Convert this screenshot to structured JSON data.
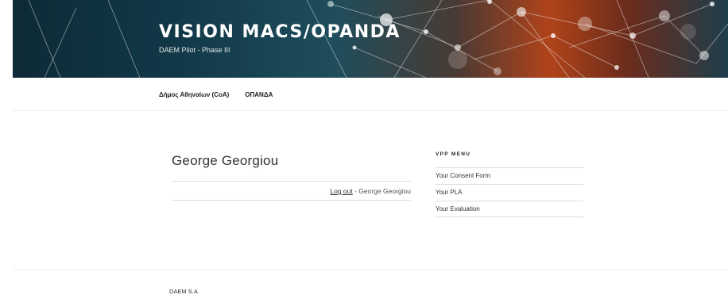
{
  "site": {
    "title": "VISION MACS/OPANDA",
    "description": "DAEM Pilot - Phase III"
  },
  "nav": {
    "items": [
      {
        "label": "Δήμος Αθηναίων (CoA)"
      },
      {
        "label": "ΟΠΑΝΔΑ"
      }
    ]
  },
  "main": {
    "page_title": "George Georgiou",
    "logout_link": "Log out",
    "logout_suffix": " - George Georgiou"
  },
  "sidebar": {
    "widget_title": "VPP MENU",
    "items": [
      {
        "label": "Your Consent Form"
      },
      {
        "label": "Your PLA"
      },
      {
        "label": "Your Evaluation"
      }
    ]
  },
  "footer": {
    "text": "DAEM S.A"
  },
  "colors": {
    "header_dark": "#0d2a36",
    "header_accent": "#b0431a",
    "divider": "#dddddd"
  },
  "icons": {
    "header_graphic": "network-graph-illustration"
  }
}
